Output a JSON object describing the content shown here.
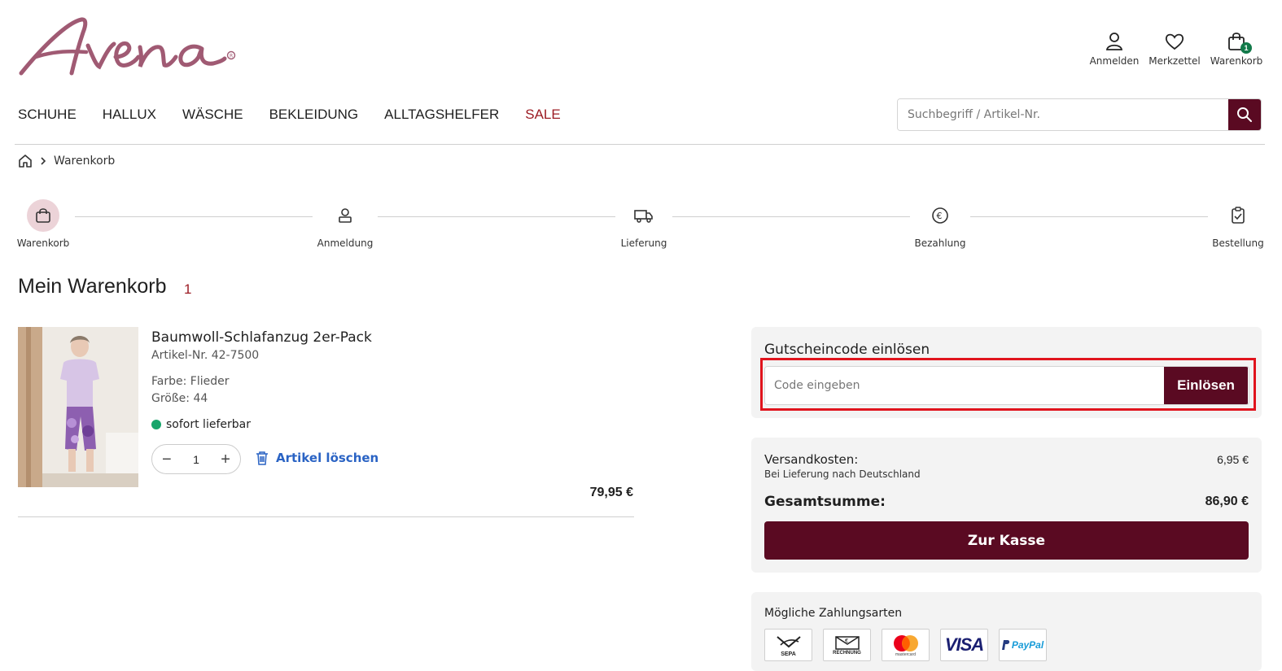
{
  "brand": {
    "logo_text": "Avena"
  },
  "header": {
    "login_label": "Anmelden",
    "wishlist_label": "Merkzettel",
    "cart_label": "Warenkorb",
    "cart_count": "1"
  },
  "nav": {
    "items": [
      "SCHUHE",
      "HALLUX",
      "WÄSCHE",
      "BEKLEIDUNG",
      "ALLTAGSHELFER",
      "SALE"
    ]
  },
  "search": {
    "placeholder": "Suchbegriff / Artikel-Nr."
  },
  "breadcrumb": {
    "current": "Warenkorb"
  },
  "checkout_steps": [
    "Warenkorb",
    "Anmeldung",
    "Lieferung",
    "Bezahlung",
    "Bestellung"
  ],
  "page": {
    "title": "Mein Warenkorb",
    "count": "1"
  },
  "product": {
    "name": "Baumwoll-Schlafanzug 2er-Pack",
    "article": "Artikel-Nr. 42-7500",
    "color": "Farbe: Flieder",
    "size": "Größe: 44",
    "availability": "sofort lieferbar",
    "quantity": "1",
    "delete_label": "Artikel löschen",
    "price": "79,95 €"
  },
  "coupon": {
    "title": "Gutscheincode einlösen",
    "placeholder": "Code eingeben",
    "button": "Einlösen"
  },
  "summary": {
    "shipping_label": "Versandkosten:",
    "shipping_note": "Bei Lieferung nach Deutschland",
    "shipping_value": "6,95 €",
    "total_label": "Gesamtsumme:",
    "total_value": "86,90 €",
    "checkout_button": "Zur Kasse"
  },
  "payment": {
    "title": "Mögliche Zahlungsarten",
    "methods": [
      "SEPA",
      "RECHNUNG",
      "mastercard",
      "VISA",
      "PayPal"
    ]
  },
  "colors": {
    "brand": "#5a0a22",
    "sale": "#9c1c24",
    "link": "#2a63c4",
    "available": "#17a56b",
    "highlight": "#e0141d"
  }
}
